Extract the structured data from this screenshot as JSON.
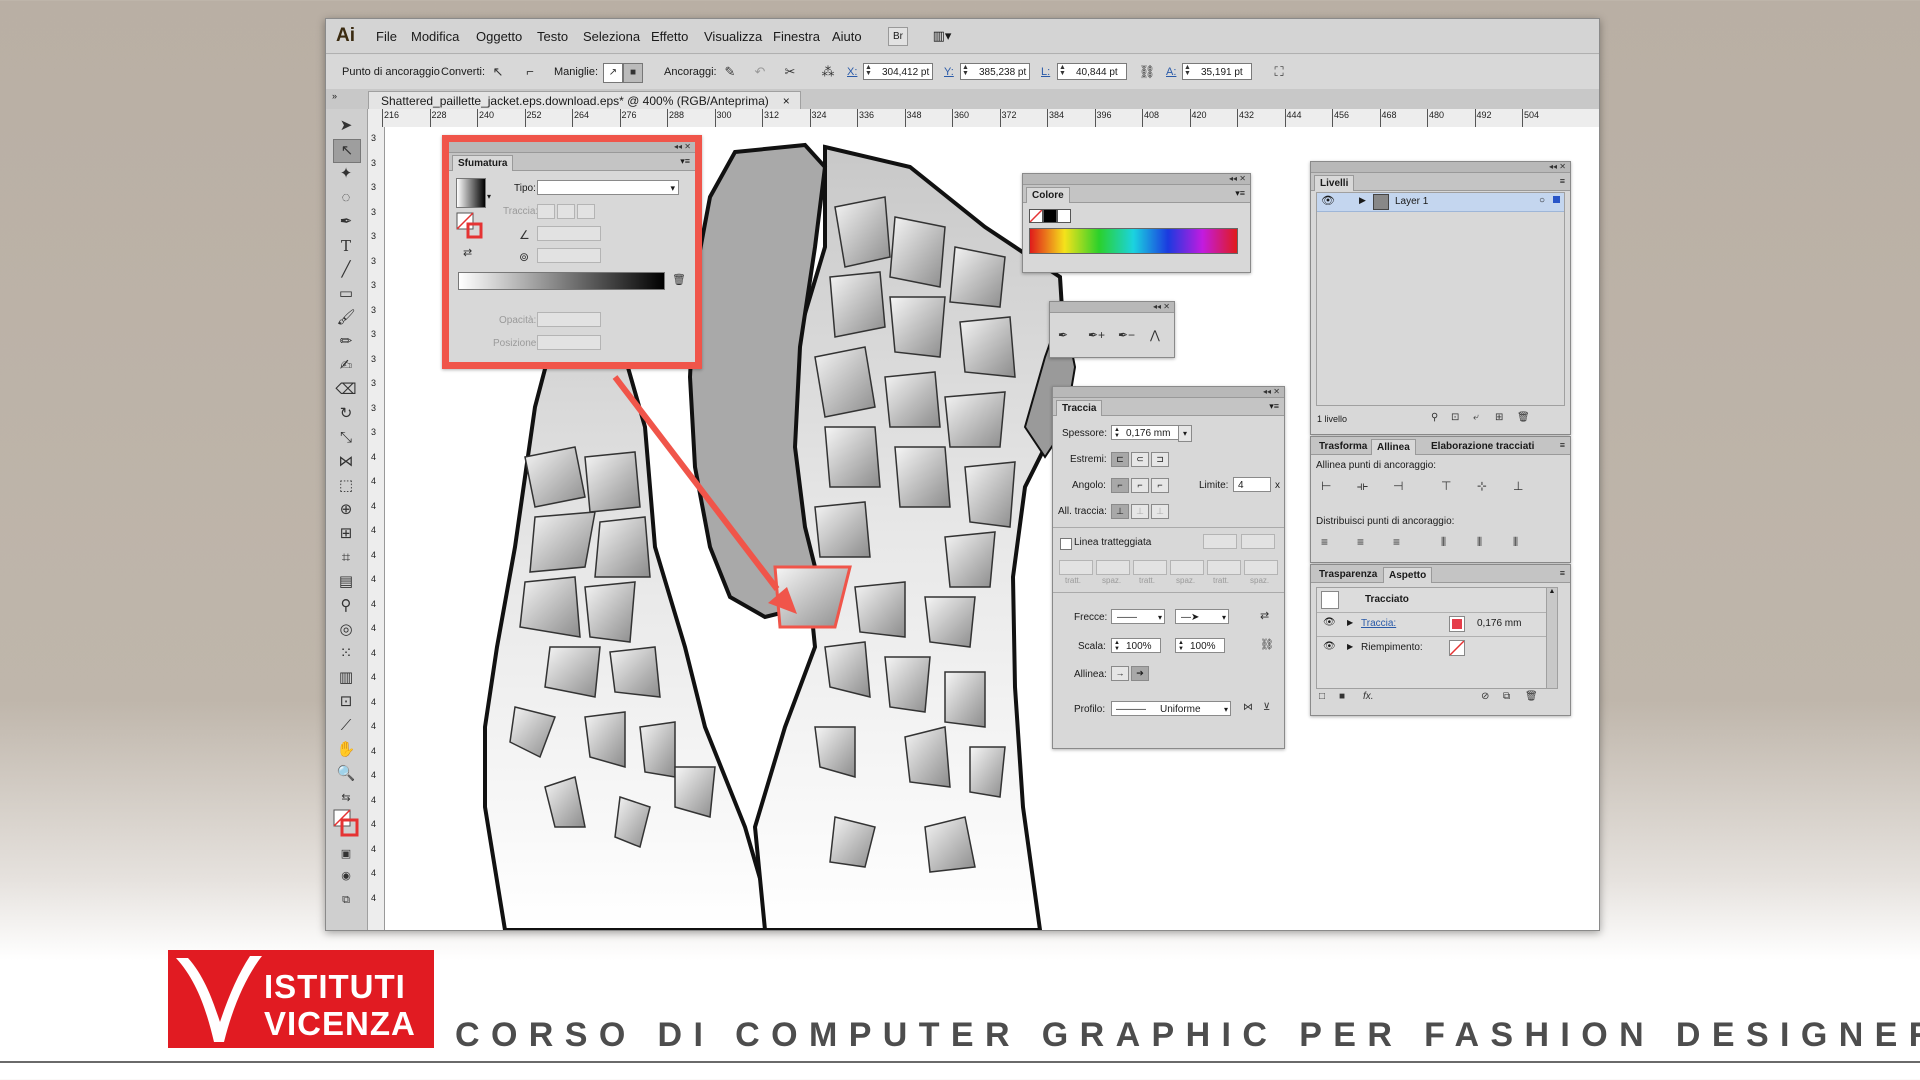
{
  "app": {
    "logo": "Ai"
  },
  "menu": [
    "File",
    "Modifica",
    "Oggetto",
    "Testo",
    "Seleziona",
    "Effetto",
    "Visualizza",
    "Finestra",
    "Aiuto"
  ],
  "menubar_buttons": {
    "bridge": "Br",
    "arrange": "▥▾"
  },
  "control": {
    "anchor_label": "Punto di ancoraggio",
    "convert_label": "Converti:",
    "handles_label": "Maniglie:",
    "anchors_label": "Ancoraggi:",
    "x_label": "X:",
    "x_value": "304,412 pt",
    "y_label": "Y:",
    "y_value": "385,238 pt",
    "w_label": "L:",
    "w_value": "40,844 pt",
    "h_label": "A:",
    "h_value": "35,191 pt"
  },
  "document": {
    "tab_title": "Shattered_paillette_jacket.eps.download.eps* @ 400% (RGB/Anteprima)",
    "close": "×"
  },
  "ruler": {
    "h": [
      "216",
      "228",
      "240",
      "252",
      "264",
      "276",
      "288",
      "300",
      "312",
      "324",
      "336",
      "348",
      "360",
      "372",
      "384",
      "396",
      "408",
      "420",
      "432",
      "444",
      "456",
      "468",
      "480",
      "492",
      "504"
    ],
    "v": [
      "3",
      "3",
      "3",
      "3",
      "3",
      "3",
      "3",
      "3",
      "3",
      "3",
      "3",
      "3",
      "3",
      "4",
      "4",
      "4",
      "4",
      "4",
      "4",
      "4",
      "4",
      "4",
      "4",
      "4",
      "4",
      "4",
      "4",
      "4",
      "4",
      "4",
      "4",
      "4"
    ]
  },
  "gradient_panel": {
    "title": "Sfumatura",
    "type_label": "Tipo:",
    "stroke_label": "Traccia:",
    "opacity_label": "Opacità:",
    "position_label": "Posizione:"
  },
  "color_panel": {
    "title": "Colore"
  },
  "stroke_panel": {
    "title": "Traccia",
    "weight_label": "Spessore:",
    "weight_value": "0,176 mm",
    "caps_label": "Estremi:",
    "corner_label": "Angolo:",
    "limit_label": "Limite:",
    "limit_value": "4",
    "limit_x": "x",
    "align_label": "All. traccia:",
    "dashed_label": "Linea tratteggiata",
    "dash_labels": [
      "tratt.",
      "spaz.",
      "tratt.",
      "spaz.",
      "tratt.",
      "spaz."
    ],
    "arrows_label": "Frecce:",
    "scale_label": "Scala:",
    "scale1": "100%",
    "scale2": "100%",
    "align2_label": "Allinea:",
    "profile_label": "Profilo:",
    "profile_value": "Uniforme"
  },
  "layers_panel": {
    "title": "Livelli",
    "layer_name": "Layer 1",
    "count": "1 livello"
  },
  "align_panel": {
    "tabs": [
      "Trasforma",
      "Allinea",
      "Elaborazione tracciati"
    ],
    "align_anchors": "Allinea punti di ancoraggio:",
    "distribute_anchors": "Distribuisci punti di ancoraggio:"
  },
  "appearance_panel": {
    "tabs": [
      "Trasparenza",
      "Aspetto"
    ],
    "object": "Tracciato",
    "stroke_label": "Traccia:",
    "stroke_value": "0,176 mm",
    "fill_label": "Riempimento:"
  },
  "brand": {
    "line1": "ISTITUTI",
    "line2": "VICENZA",
    "course": "CORSO DI COMPUTER GRAPHIC PER FASHION DESIGNER"
  },
  "colors": {
    "highlight": "#f0554a",
    "brand_red": "#e11b22"
  }
}
